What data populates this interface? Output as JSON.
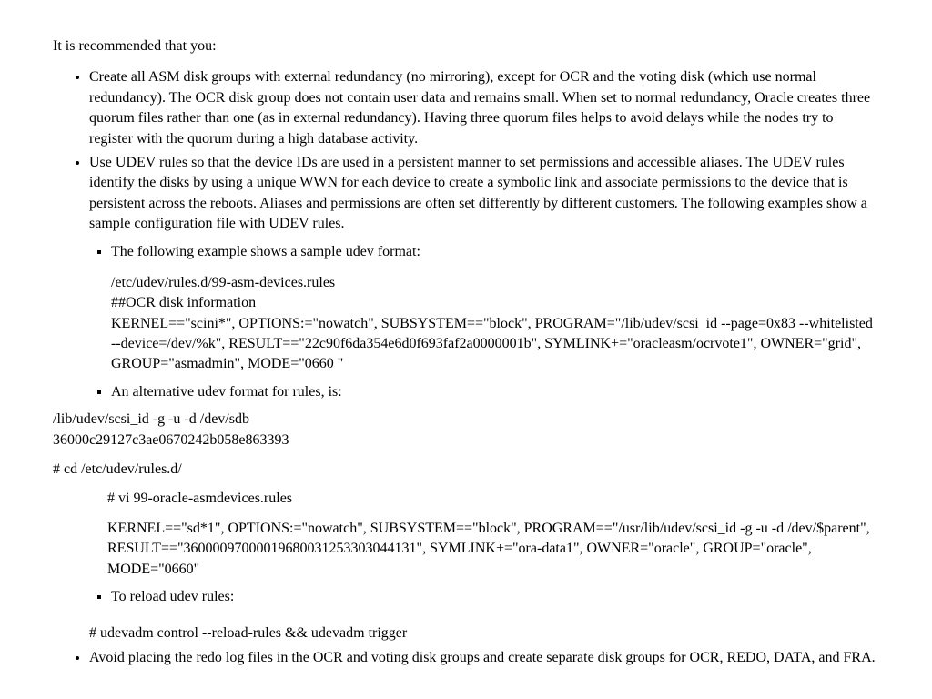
{
  "intro": "It is recommended that you:",
  "bullet1": "Create all ASM disk groups with external redundancy (no mirroring), except for OCR and the voting disk (which use normal redundancy). The OCR disk group does not contain user data and remains small. When set to normal redundancy, Oracle creates three quorum files rather than one (as in external redundancy). Having three quorum files helps to avoid delays while the nodes try to register with the quorum during a high database activity.",
  "bullet2": "Use UDEV rules so that the device IDs are used in a persistent manner to set permissions and accessible aliases. The UDEV rules identify the disks by using a unique WWN for each device to create a symbolic link and associate permissions to the device that is persistent across the reboots. Aliases and permissions are often set differently by different customers. The following examples show a sample configuration file with UDEV rules.",
  "sub1": "The following example shows a sample udev format:",
  "code1_l1": "/etc/udev/rules.d/99-asm-devices.rules",
  "code1_l2": "##OCR disk information",
  "code1_l3": "KERNEL==\"scini*\", OPTIONS:=\"nowatch\", SUBSYSTEM==\"block\", PROGRAM=\"/lib/udev/scsi_id --page=0x83 --whitelisted --device=/dev/%k\", RESULT==\"22c90f6da354e6d0f693faf2a0000001b\", SYMLINK+=\"oracleasm/ocrvote1\", OWNER=\"grid\", GROUP=\"asmadmin\", MODE=\"0660 \"",
  "sub2": "An alternative udev format for rules, is:",
  "code2_l1": "/lib/udev/scsi_id -g -u -d /dev/sdb",
  "code2_l2": "36000c29127c3ae0670242b058e863393",
  "code3": "# cd /etc/udev/rules.d/",
  "code4": "# vi 99-oracle-asmdevices.rules",
  "code5": "KERNEL==\"sd*1\", OPTIONS:=\"nowatch\", SUBSYSTEM==\"block\", PROGRAM==\"/usr/lib/udev/scsi_id -g -u -d /dev/$parent\", RESULT==\"36000097000019680031253303044131\", SYMLINK+=\"ora-data1\", OWNER=\"oracle\", GROUP=\"oracle\", MODE=\"0660\"",
  "sub3": "To reload udev rules:",
  "code6": "# udevadm control --reload-rules && udevadm trigger",
  "bullet3": "Avoid placing the redo log files in the OCR and voting disk groups and create separate disk groups for OCR, REDO, DATA, and FRA."
}
